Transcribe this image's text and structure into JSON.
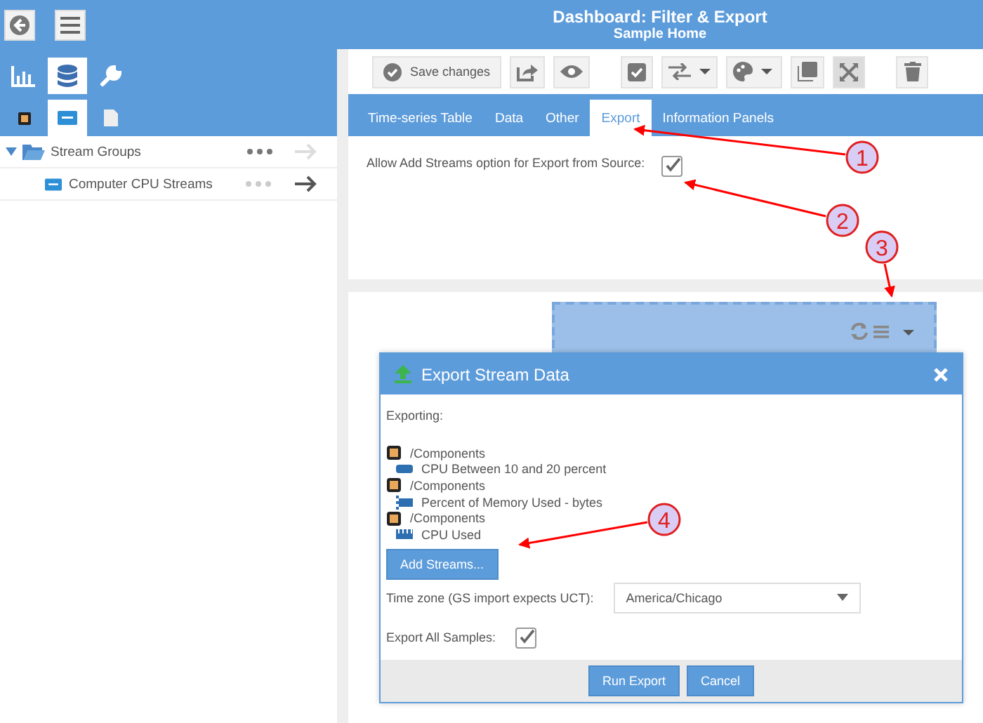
{
  "header": {
    "title": "Dashboard: Filter & Export",
    "subtitle": "Sample Home"
  },
  "sidebar": {
    "top_tabs": [
      {
        "selected": false
      },
      {
        "selected": true
      },
      {
        "selected": false
      }
    ],
    "sub_tabs": [
      {
        "selected": false
      },
      {
        "selected": true
      },
      {
        "selected": false
      }
    ],
    "tree": [
      {
        "label": "Stream Groups",
        "expanded": true,
        "children": [
          {
            "label": "Computer CPU Streams"
          }
        ]
      }
    ]
  },
  "toolbar": {
    "save_label": "Save changes",
    "expand_selected": true
  },
  "tabs": [
    {
      "label": "Time-series Table",
      "selected": false
    },
    {
      "label": "Data",
      "selected": false
    },
    {
      "label": "Other",
      "selected": false
    },
    {
      "label": "Export",
      "selected": true
    },
    {
      "label": "Information Panels",
      "selected": false
    }
  ],
  "option": {
    "label": "Allow Add Streams option for Export from Source:",
    "checked": true
  },
  "callouts": [
    {
      "label": "1"
    },
    {
      "label": "2"
    },
    {
      "label": "3"
    },
    {
      "label": "4"
    }
  ],
  "dialog": {
    "title": "Export Stream Data",
    "exporting_label": "Exporting:",
    "items": [
      {
        "path": "/Components",
        "stream": "CPU Between 10 and 20 percent"
      },
      {
        "path": "/Components",
        "stream": "Percent of Memory Used - bytes"
      },
      {
        "path": "/Components",
        "stream": "CPU Used"
      }
    ],
    "add_button": "Add Streams...",
    "timezone_label": "Time zone (GS import expects UCT):",
    "timezone_value": "America/Chicago",
    "export_all_label": "Export All Samples:",
    "export_all_checked": true,
    "buttons": [
      "Run Export",
      "Cancel"
    ]
  }
}
